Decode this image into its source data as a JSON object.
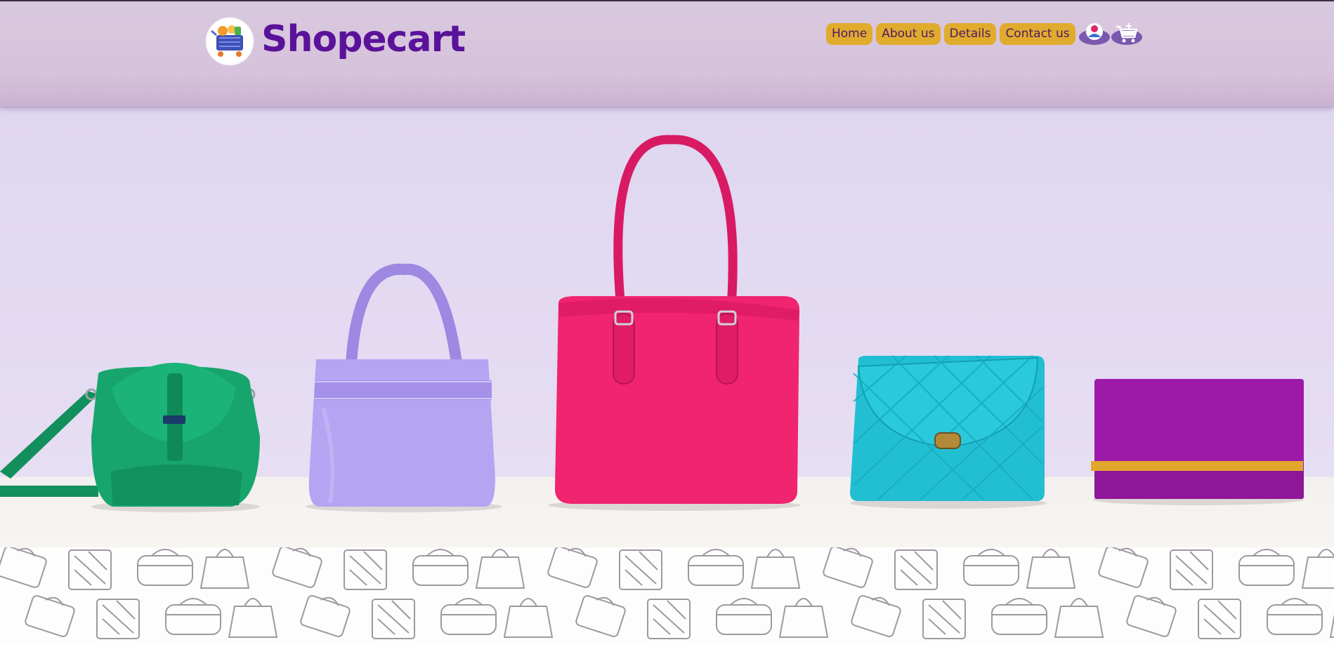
{
  "brand": {
    "name": "Shopecart"
  },
  "nav": {
    "links": [
      {
        "label": "Home"
      },
      {
        "label": "About us"
      },
      {
        "label": "Details"
      },
      {
        "label": "Contact us"
      }
    ],
    "account_icon": "user-icon",
    "cart_icon": "cart-icon"
  },
  "colors": {
    "brand": "#5b129a",
    "nav_button": "#e1ab2e",
    "nav_text": "#4e1a63",
    "header_bg": "#d6c2dc"
  }
}
